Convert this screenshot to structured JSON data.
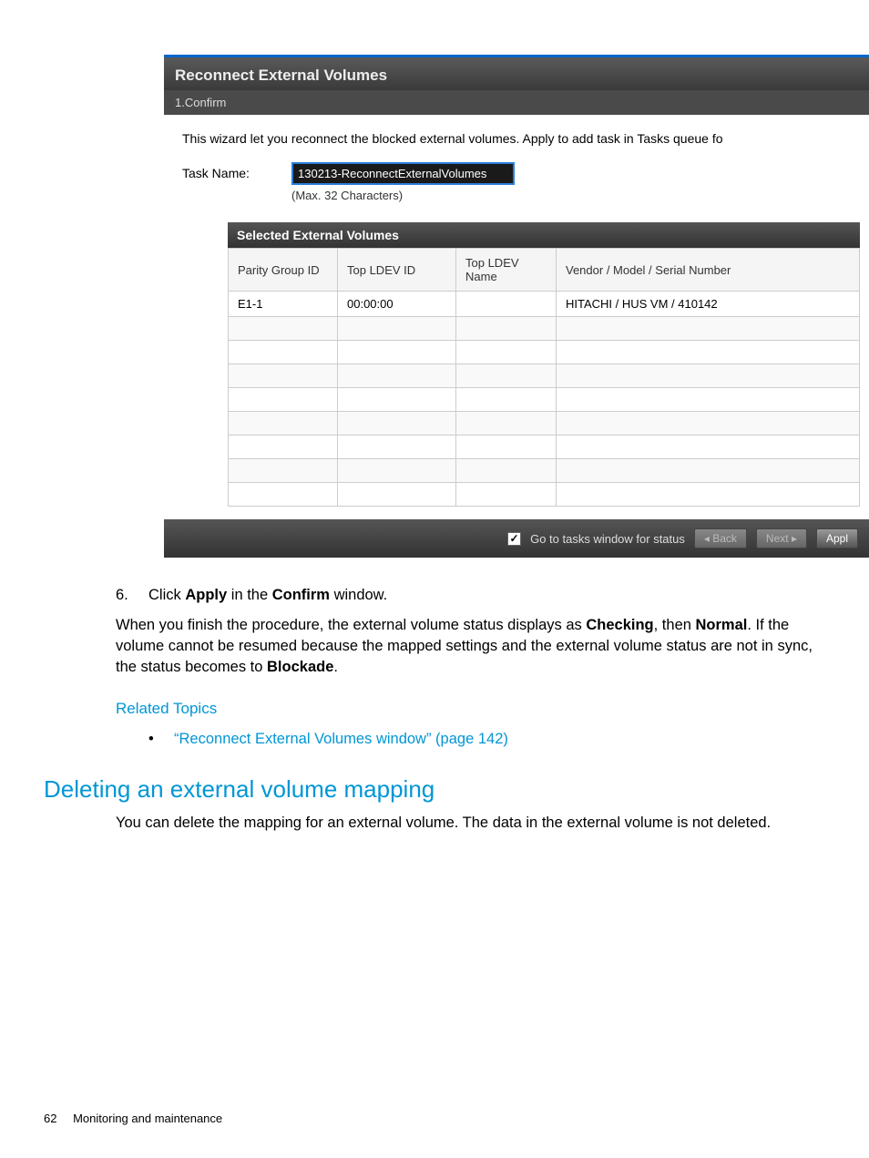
{
  "screenshot": {
    "title": "Reconnect External Volumes",
    "step": "1.Confirm",
    "description": "This wizard let you reconnect the blocked external volumes. Apply to add task in Tasks queue fo",
    "task_name_label": "Task Name:",
    "task_name_value": "130213-ReconnectExternalVolumes",
    "task_name_hint": "(Max. 32 Characters)",
    "table_title": "Selected External Volumes",
    "columns": {
      "c1": "Parity Group ID",
      "c2": "Top LDEV ID",
      "c3": "Top LDEV Name",
      "c4": "Vendor / Model / Serial Number"
    },
    "row": {
      "c1": "E1-1",
      "c2": "00:00:00",
      "c3": "",
      "c4": "HITACHI / HUS VM / 410142"
    },
    "footer": {
      "checkbox_label": "Go to tasks window for status",
      "back": "Back",
      "next": "Next",
      "apply": "Appl"
    }
  },
  "doc": {
    "step_number": "6.",
    "step_text_pre": "Click ",
    "step_text_b1": "Apply",
    "step_text_mid": " in the ",
    "step_text_b2": "Confirm",
    "step_text_post": " window.",
    "para_pre": "When you finish the procedure, the external volume status displays as ",
    "para_b1": "Checking",
    "para_mid1": ", then ",
    "para_b2": "Normal",
    "para_mid2": ". If the volume cannot be resumed because the mapped settings and the external volume status are not in sync, the status becomes to ",
    "para_b3": "Blockade",
    "para_end": ".",
    "related": "Related Topics",
    "bullet": "•",
    "link": "“Reconnect External Volumes window” (page 142)",
    "heading": "Deleting an external volume mapping",
    "heading_para": "You can delete the mapping for an external volume. The data in the external volume is not deleted.",
    "page_number": "62",
    "footer_text": "Monitoring and maintenance"
  }
}
